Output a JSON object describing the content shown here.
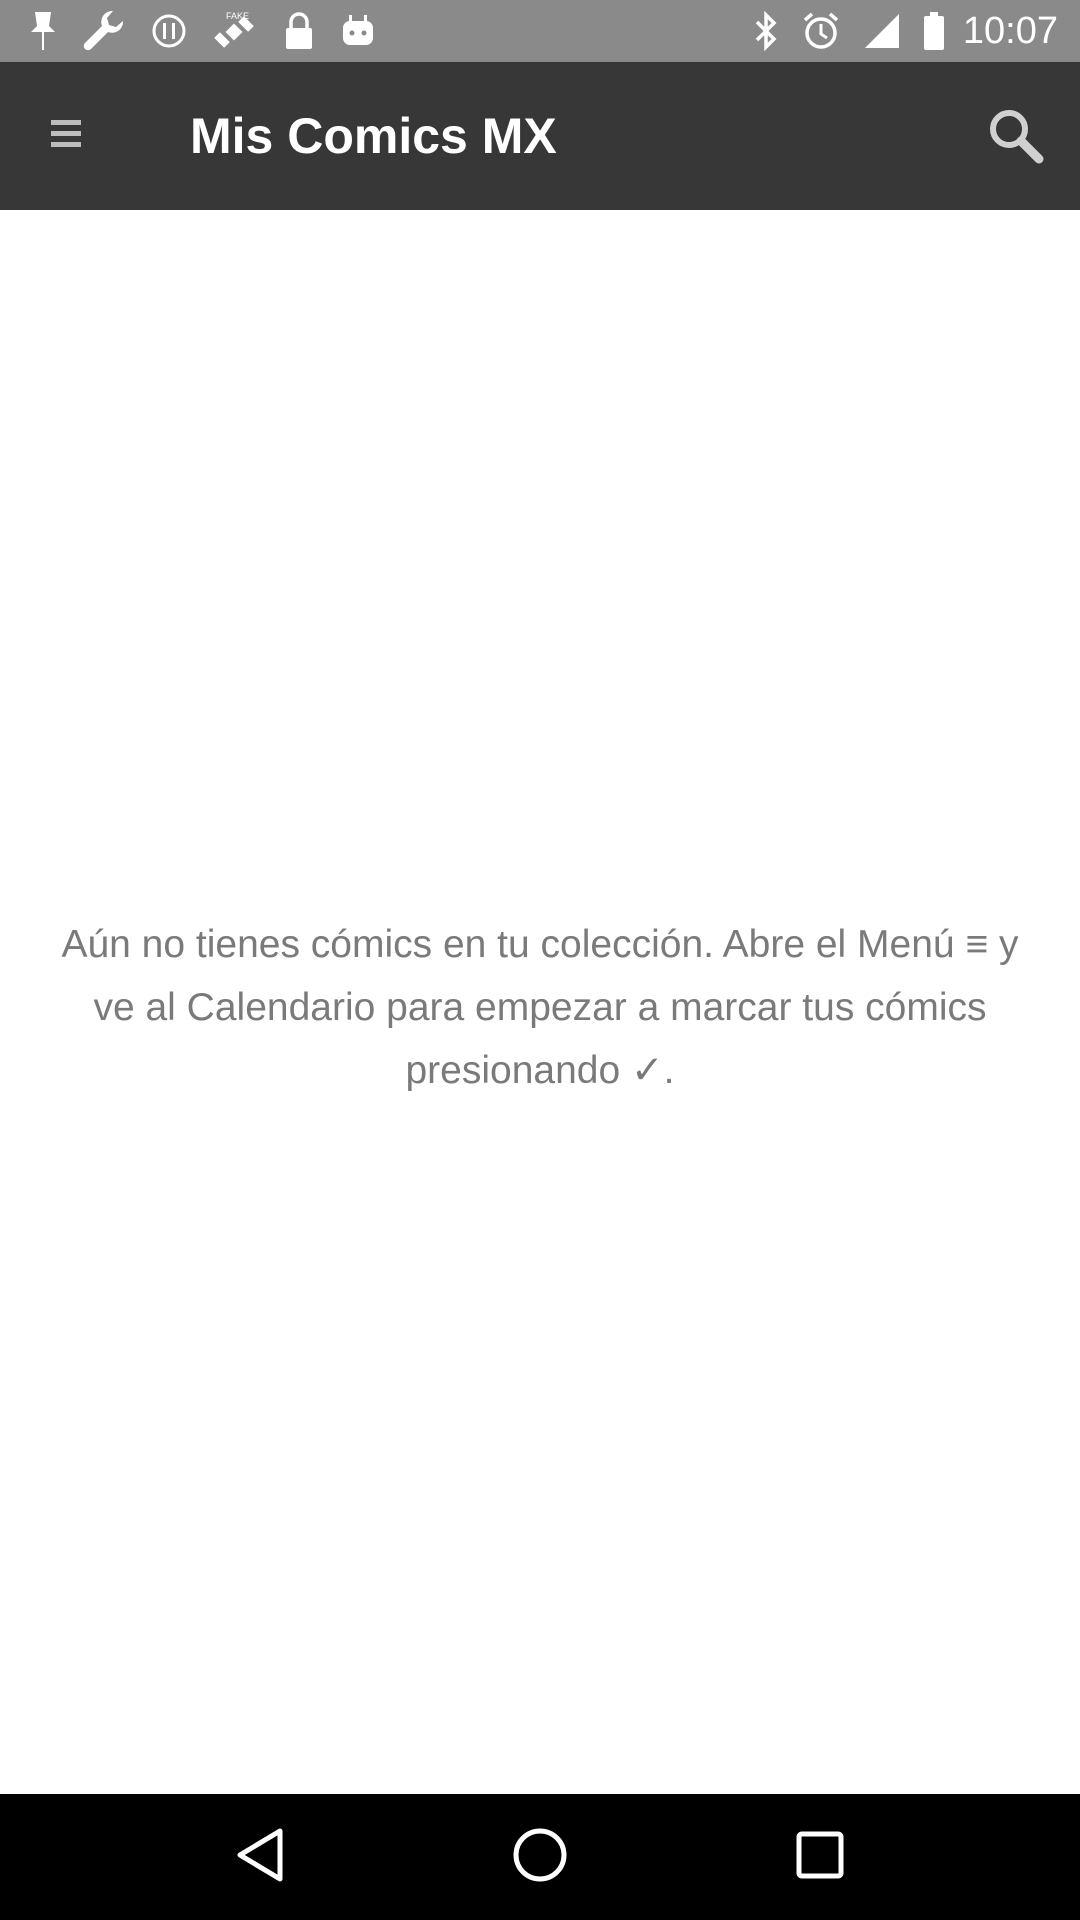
{
  "status_bar": {
    "left_icons": [
      "notification-icon",
      "wrench-icon",
      "alert-icon",
      "satellite-icon",
      "lock-icon",
      "android-icon"
    ],
    "satellite_label": "FAKE",
    "right_icons": [
      "bluetooth-icon",
      "alarm-icon",
      "signal-icon",
      "battery-icon"
    ],
    "time": "10:07"
  },
  "app_bar": {
    "menu_icon": "hamburger-menu-icon",
    "title": "Mis Comics MX",
    "search_icon": "search-icon",
    "background": "#373737"
  },
  "main": {
    "empty_message": "Aún no tienes cómics en tu colección. Abre el Menú ≡ y ve al Calendario para empezar a marcar tus cómics presionando ✓."
  },
  "nav_bar": {
    "buttons": [
      "back-icon",
      "home-icon",
      "recents-icon"
    ]
  }
}
